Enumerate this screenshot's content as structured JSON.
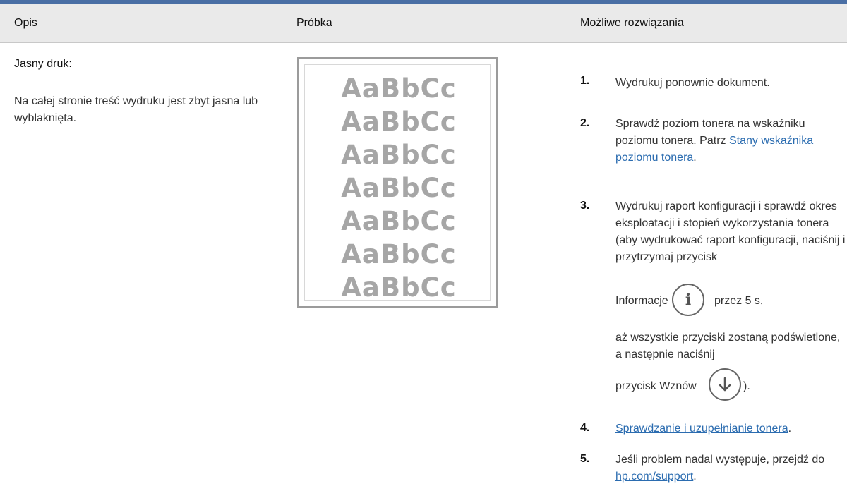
{
  "header": {
    "col_description": "Opis",
    "col_sample": "Próbka",
    "col_solutions": "Możliwe rozwiązania"
  },
  "issue": {
    "title": "Jasny druk:",
    "description": "Na całej stronie treść wydruku jest zbyt jasna lub wyblaknięta."
  },
  "sample": {
    "lines": [
      "AaBbCc",
      "AaBbCc",
      "AaBbCc",
      "AaBbCc",
      "AaBbCc",
      "AaBbCc",
      "AaBbCc"
    ]
  },
  "steps": [
    {
      "num": "1.",
      "text": "Wydrukuj ponownie dokument."
    },
    {
      "num": "2.",
      "text_a": "Sprawdź poziom tonera na wskaźniku poziomu tonera. Patrz ",
      "link": "Stany wskaźnika poziomu tonera",
      "text_b": "."
    },
    {
      "num": "3.",
      "text_a": "Wydrukuj raport konfiguracji i sprawdź okres eksploatacji i stopień wykorzystania tonera (aby wydrukować raport konfiguracji, naciśnij i przytrzymaj przycisk",
      "info_label": "Informacje",
      "info_after": "przez 5 s,",
      "text_c": "aż wszystkie przyciski zostaną podświetlone, a następnie naciśnij",
      "resume_label": "przycisk Wznów",
      "resume_after": ")."
    },
    {
      "num": "4.",
      "link": "Sprawdzanie i uzupełnianie tonera",
      "text_b": "."
    },
    {
      "num": "5.",
      "text_a": "Jeśli problem nadal występuje, przejdź do ",
      "link": "hp.com/support",
      "text_b": "."
    }
  ],
  "icons": {
    "info": "info-icon",
    "resume": "arrow-down-icon"
  },
  "colors": {
    "accent_rule": "#4a6fa5",
    "link": "#2b6cb0",
    "sample_text": "#a6a6a6"
  }
}
